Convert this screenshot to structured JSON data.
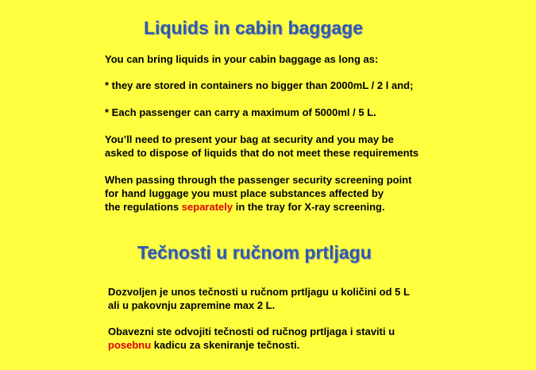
{
  "english": {
    "title": "Liquids in cabin baggage",
    "intro": "You can bring liquids in your cabin baggage as long as:",
    "rule1": "* they are stored in containers no bigger than 2000mL / 2 l and;",
    "rule2": "* Each passenger can carry a maximum of 5000ml / 5 L.",
    "security_line1": "You’ll need to present your bag at security and you may be",
    "security_line2": "asked to dispose of liquids that do not meet these requirements",
    "screening_line1": "When passing through the passenger security screening point",
    "screening_line2": "for hand luggage you must place substances affected by",
    "screening_line3_before": "the regulations ",
    "screening_line3_highlight": "separately",
    "screening_line3_after": " in the tray for X-ray screening."
  },
  "serbian": {
    "title": "Tečnosti u ručnom prtljagu",
    "allowed_line1": "Dozvoljen je unos tečnosti u ručnom prtljagu u količini od 5 L",
    "allowed_line2": "ali u pakovnju zapremine max 2 L.",
    "obligation_line1": "Obavezni ste odvojiti tečnosti od ručnog prtljaga i staviti u",
    "obligation_line2_highlight": "posebnu",
    "obligation_line2_after": " kadicu za skeniranje tečnosti."
  },
  "colors": {
    "background": "#ffff40",
    "title": "#2f5aa8",
    "highlight": "#e00000"
  }
}
